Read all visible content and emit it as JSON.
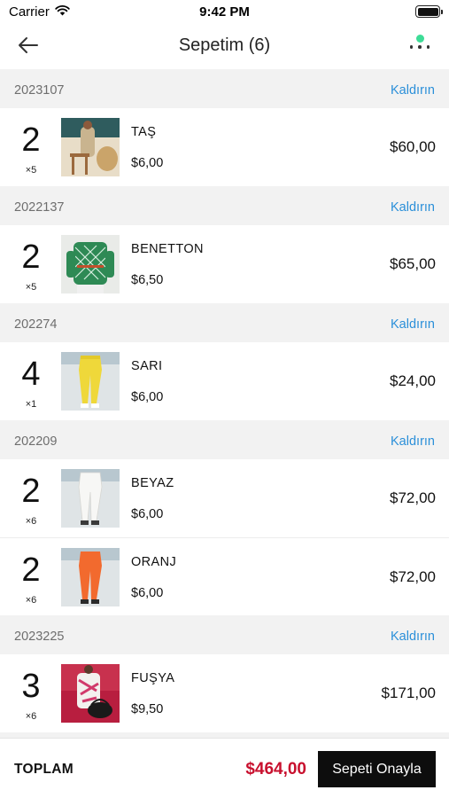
{
  "status_bar": {
    "carrier": "Carrier",
    "time": "9:42 PM"
  },
  "nav": {
    "title": "Sepetim  (6)"
  },
  "groups": [
    {
      "code": "2023107",
      "remove_label": "Kaldırın",
      "items": [
        {
          "qty": "2",
          "multiplier": "×5",
          "name": "TAŞ",
          "unit_price": "$6,00",
          "total": "$60,00"
        }
      ]
    },
    {
      "code": "2022137",
      "remove_label": "Kaldırın",
      "items": [
        {
          "qty": "2",
          "multiplier": "×5",
          "name": "BENETTON",
          "unit_price": "$6,50",
          "total": "$65,00"
        }
      ]
    },
    {
      "code": "202274",
      "remove_label": "Kaldırın",
      "items": [
        {
          "qty": "4",
          "multiplier": "×1",
          "name": "SARI",
          "unit_price": "$6,00",
          "total": "$24,00"
        }
      ]
    },
    {
      "code": "202209",
      "remove_label": "Kaldırın",
      "items": [
        {
          "qty": "2",
          "multiplier": "×6",
          "name": "BEYAZ",
          "unit_price": "$6,00",
          "total": "$72,00"
        },
        {
          "qty": "2",
          "multiplier": "×6",
          "name": "ORANJ",
          "unit_price": "$6,00",
          "total": "$72,00"
        }
      ]
    },
    {
      "code": "2023225",
      "remove_label": "Kaldırın",
      "items": [
        {
          "qty": "3",
          "multiplier": "×6",
          "name": "FUŞYA",
          "unit_price": "$9,50",
          "total": "$171,00"
        }
      ]
    }
  ],
  "footer": {
    "total_label": "TOPLAM",
    "total_value": "$464,00",
    "confirm_label": "Sepeti Onayla"
  },
  "colors": {
    "accent_link": "#2a8fd9",
    "total_red": "#c8102e",
    "button_black": "#0d0d0d",
    "notification": "#3ddc97"
  },
  "icons": {
    "back": "arrow-left-icon",
    "more": "more-dots-icon",
    "wifi": "wifi-icon",
    "battery": "battery-icon"
  }
}
